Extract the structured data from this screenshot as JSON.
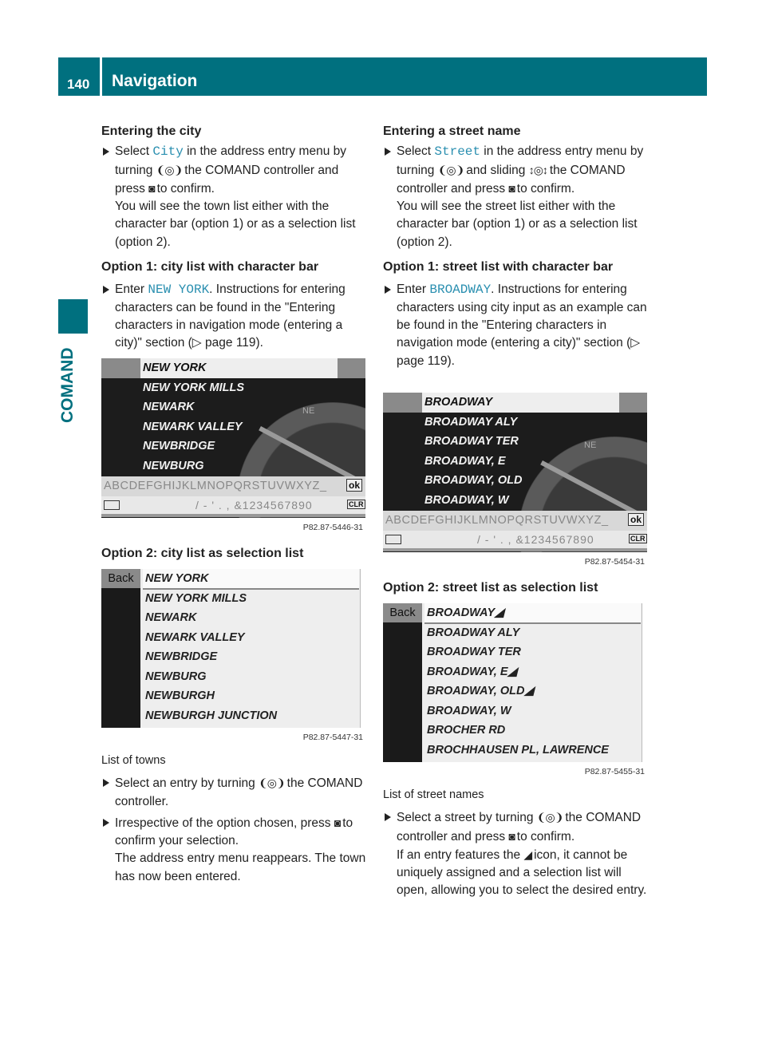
{
  "header": {
    "page_number": "140",
    "title": "Navigation",
    "side_tab": "COMAND"
  },
  "colors": {
    "accent": "#00707f",
    "code": "#2a8fb0"
  },
  "left": {
    "heading1": "Entering the city",
    "step1": [
      {
        "t": "Select "
      },
      {
        "c": "City"
      },
      {
        "t": " in the address entry menu by turning "
      },
      {
        "i": "controller-turn-icon"
      },
      {
        "t": " the COMAND controller and press "
      },
      {
        "i": "controller-press-icon"
      },
      {
        "t": " to confirm."
      }
    ],
    "step1_note": "You will see the town list either with the character bar (option 1) or as a selection list (option 2).",
    "heading2": "Option 1: city list with character bar",
    "step2": [
      {
        "t": "Enter "
      },
      {
        "c": "NEW YORK"
      },
      {
        "t": ". Instructions for entering characters can be found in the \"Entering characters in navigation mode (entering a city)\" section (▷ page 119)."
      }
    ],
    "screen1": {
      "rows": [
        "NEW YORK",
        "NEW YORK MILLS",
        "NEWARK",
        "NEWARK VALLEY",
        "NEWBRIDGE",
        "NEWBURG"
      ],
      "char_bar": "ABCDEFGHIJKLMNOPQRSTUVWXYZ_",
      "ok": "ok",
      "symbols": "/ - ' . , &1234567890",
      "clr": "CLR",
      "compass_label": "NE",
      "caption": "P82.87-5446-31"
    },
    "heading3": "Option 2: city list as selection list",
    "screen2": {
      "back": "Back",
      "rows": [
        "NEW YORK",
        "NEW YORK MILLS",
        "NEWARK",
        "NEWARK VALLEY",
        "NEWBRIDGE",
        "NEWBURG",
        "NEWBURGH",
        "NEWBURGH JUNCTION"
      ],
      "caption": "P82.87-5447-31"
    },
    "list_caption": "List of towns",
    "step3": [
      {
        "t": "Select an entry by turning "
      },
      {
        "i": "controller-turn-icon"
      },
      {
        "t": " the COMAND controller."
      }
    ],
    "step4": [
      {
        "t": "Irrespective of the option chosen, press "
      },
      {
        "i": "controller-press-icon"
      },
      {
        "t": " to confirm your selection."
      }
    ],
    "step4_note": "The address entry menu reappears. The town has now been entered."
  },
  "right": {
    "heading1": "Entering a street name",
    "step1": [
      {
        "t": "Select "
      },
      {
        "c": "Street"
      },
      {
        "t": " in the address entry menu by turning "
      },
      {
        "i": "controller-turn-icon"
      },
      {
        "t": " and sliding "
      },
      {
        "i": "controller-slide-icon"
      },
      {
        "t": " the COMAND controller and press "
      },
      {
        "i": "controller-press-icon"
      },
      {
        "t": " to confirm."
      }
    ],
    "step1_note": "You will see the street list either with the character bar (option 1) or as a selection list (option 2).",
    "heading2": "Option 1: street list with character bar",
    "step2": [
      {
        "t": "Enter  "
      },
      {
        "c": "BROADWAY"
      },
      {
        "t": ". Instructions for entering characters using city input as an example can be found in the \"Entering characters in navigation mode (entering a city)\" section (▷ page 119)."
      }
    ],
    "screen1": {
      "rows": [
        "BROADWAY",
        "BROADWAY ALY",
        "BROADWAY TER",
        "BROADWAY, E",
        "BROADWAY, OLD",
        "BROADWAY, W"
      ],
      "char_bar": "ABCDEFGHIJKLMNOPQRSTUVWXYZ_",
      "ok": "ok",
      "symbols": "/ - ' . , &1234567890",
      "clr": "CLR",
      "compass_label": "NE",
      "caption": "P82.87-5454-31"
    },
    "heading3": "Option 2: street list as selection list",
    "screen2": {
      "back": "Back",
      "rows": [
        "BROADWAY◢",
        "BROADWAY ALY",
        "BROADWAY TER",
        "BROADWAY, E◢",
        "BROADWAY, OLD◢",
        "BROADWAY, W",
        "BROCHER RD",
        "BROCHHAUSEN PL, LAWRENCE"
      ],
      "caption": "P82.87-5455-31"
    },
    "list_caption": "List of street names",
    "step3": [
      {
        "t": "Select a street by turning "
      },
      {
        "i": "controller-turn-icon"
      },
      {
        "t": " the COMAND controller and press "
      },
      {
        "i": "controller-press-icon"
      },
      {
        "t": " to confirm."
      }
    ],
    "step3_note": [
      {
        "t": "If an entry features the "
      },
      {
        "i": "multiple-entries-icon"
      },
      {
        "t": " icon, it cannot be uniquely assigned and a selection list will open, allowing you to select the desired entry."
      }
    ]
  }
}
